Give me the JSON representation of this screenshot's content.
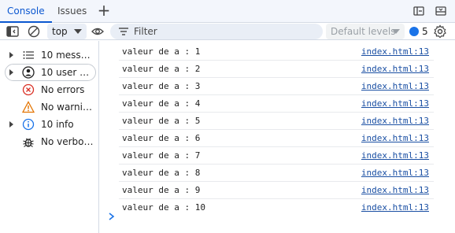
{
  "tabs": {
    "console": "Console",
    "issues": "Issues"
  },
  "toolbar": {
    "context": "top",
    "filter_placeholder": "Filter",
    "levels": "Default levels",
    "issues_count": "5"
  },
  "sidebar": {
    "items": [
      {
        "label": "10 messages",
        "icon": "list-icon"
      },
      {
        "label": "10 user messages",
        "icon": "user-icon"
      },
      {
        "label": "No errors",
        "icon": "error-icon"
      },
      {
        "label": "No warnings",
        "icon": "warning-icon"
      },
      {
        "label": "10 info",
        "icon": "info-icon"
      },
      {
        "label": "No verbose",
        "icon": "bug-icon"
      }
    ]
  },
  "console": {
    "rows": [
      {
        "msg": "valeur de a : 1",
        "src": "index.html:13"
      },
      {
        "msg": "valeur de a : 2",
        "src": "index.html:13"
      },
      {
        "msg": "valeur de a : 3",
        "src": "index.html:13"
      },
      {
        "msg": "valeur de a : 4",
        "src": "index.html:13"
      },
      {
        "msg": "valeur de a : 5",
        "src": "index.html:13"
      },
      {
        "msg": "valeur de a : 6",
        "src": "index.html:13"
      },
      {
        "msg": "valeur de a : 7",
        "src": "index.html:13"
      },
      {
        "msg": "valeur de a : 8",
        "src": "index.html:13"
      },
      {
        "msg": "valeur de a : 9",
        "src": "index.html:13"
      },
      {
        "msg": "valeur de a : 10",
        "src": "index.html:13"
      }
    ]
  },
  "colors": {
    "accent": "#0b57d0",
    "link": "#1a4fa3",
    "error": "#d93025",
    "warning": "#e37400",
    "info": "#1a73e8"
  }
}
